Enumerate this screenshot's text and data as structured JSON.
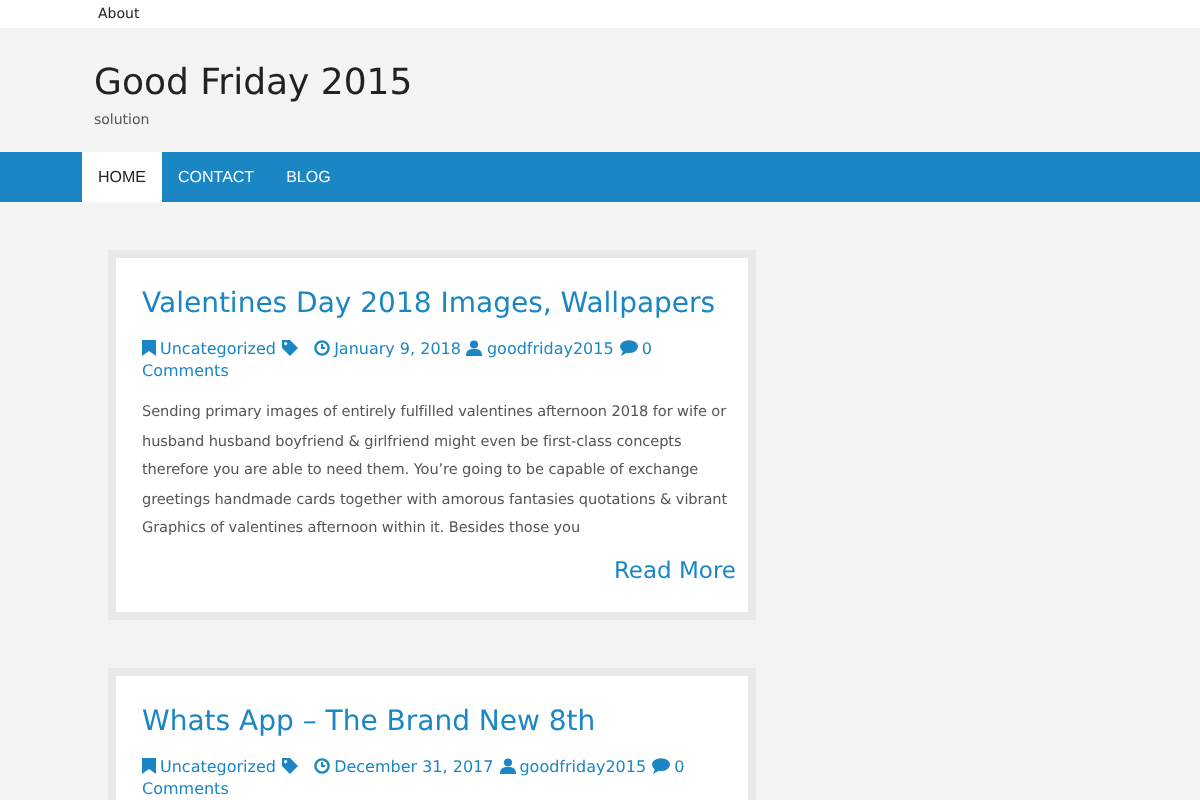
{
  "top_menu": [
    "About"
  ],
  "site": {
    "title": "Good Friday 2015",
    "tagline": "solution"
  },
  "nav": [
    {
      "label": "HOME",
      "selected": true
    },
    {
      "label": "CONTACT",
      "selected": false
    },
    {
      "label": "BLOG",
      "selected": false
    }
  ],
  "posts": [
    {
      "title": "Valentines Day 2018 Images, Wallpapers",
      "category": "Uncategorized",
      "date": "January 9, 2018",
      "author": "goodfriday2015",
      "comment_count": "0",
      "comment_label": "Comments",
      "excerpt": "Sending primary images of entirely fulfilled valentines afternoon 2018 for wife or husband husband boyfriend & girlfriend might even be first-class concepts therefore you are able to need them. You’re going to be capable of exchange greetings handmade cards together with amorous fantasies quotations & vibrant Graphics of valentines afternoon within it. Besides those you",
      "read_more": "Read More"
    },
    {
      "title": "Whats App – The Brand New 8th",
      "category": "Uncategorized",
      "date": "December 31, 2017",
      "author": "goodfriday2015",
      "comment_count": "0",
      "comment_label": "Comments"
    }
  ]
}
